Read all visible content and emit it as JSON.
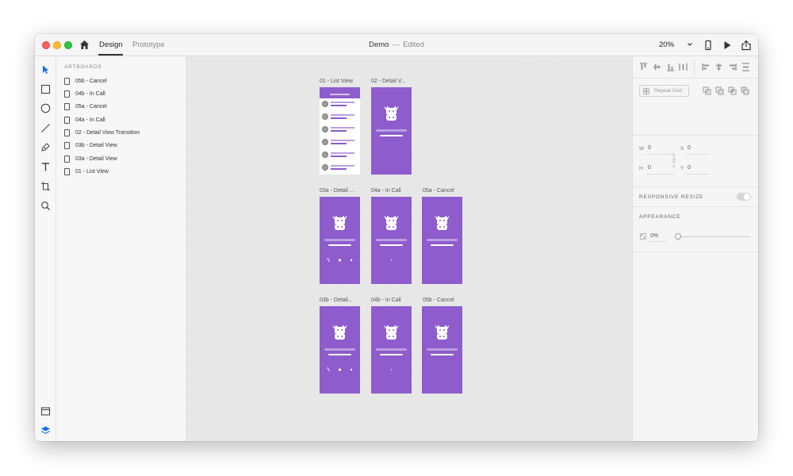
{
  "titlebar": {
    "tabs": [
      {
        "label": "Design",
        "active": true
      },
      {
        "label": "Prototype",
        "active": false
      }
    ],
    "doc_name": "Demo",
    "separator": "—",
    "doc_status": "Edited",
    "zoom": "20%",
    "icons": [
      "home-icon",
      "chevron-down-icon",
      "phone-preview-icon",
      "play-icon",
      "share-icon"
    ]
  },
  "toolbar": {
    "tools": [
      "select-tool-icon",
      "rectangle-tool-icon",
      "ellipse-tool-icon",
      "line-tool-icon",
      "pen-tool-icon",
      "text-tool-icon",
      "artboard-tool-icon",
      "zoom-tool-icon"
    ],
    "bottom": [
      "assets-icon",
      "layers-icon"
    ]
  },
  "layers": {
    "heading": "ARTBOARDS",
    "items": [
      "05b - Cancel",
      "04b - In Call",
      "05a - Cancel",
      "04a - In Call",
      "02 - Detail View Transition",
      "03b - Detail View",
      "03a - Detail View",
      "01 - List View"
    ]
  },
  "canvas": {
    "artboards": [
      {
        "label": "01 - List View",
        "kind": "list"
      },
      {
        "label": "02 - Detail V...",
        "kind": "detail"
      },
      {
        "label": "03a - Detail ...",
        "kind": "detail-call"
      },
      {
        "label": "04a - In Call",
        "kind": "in-call"
      },
      {
        "label": "05a - Cancel",
        "kind": "cancel"
      },
      {
        "label": "03b - Detail...",
        "kind": "detail-call"
      },
      {
        "label": "04b - In Call",
        "kind": "in-call"
      },
      {
        "label": "05b - Cancel",
        "kind": "cancel"
      }
    ]
  },
  "properties": {
    "repeat_grid": "Repeat Grid",
    "w_label": "W",
    "w_value": "0",
    "x_label": "X",
    "x_value": "0",
    "h_label": "H",
    "h_value": "0",
    "y_label": "Y",
    "y_value": "0",
    "responsive_resize": "RESPONSIVE RESIZE",
    "appearance": "APPEARANCE",
    "opacity": "0%"
  },
  "colors": {
    "artboard_purple": "#8e5ccc",
    "accent_blue": "#1473e6"
  }
}
